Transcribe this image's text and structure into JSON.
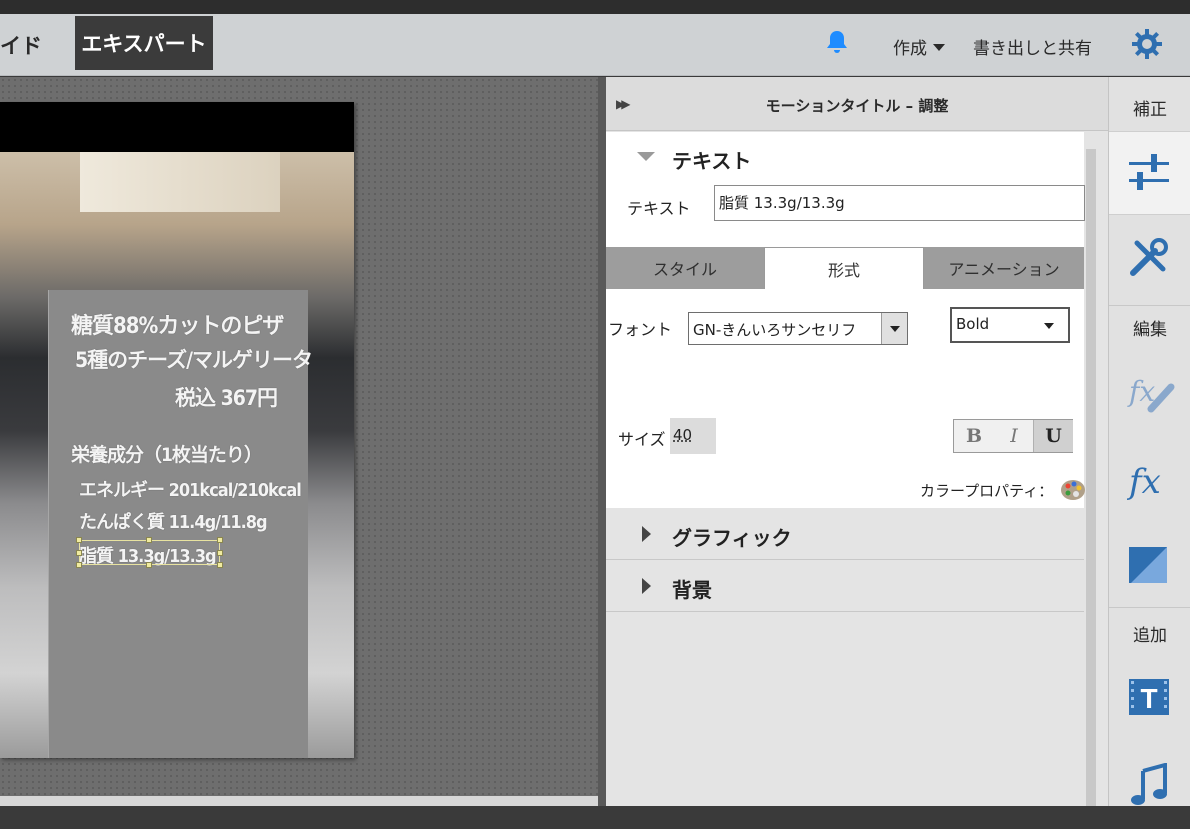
{
  "header": {
    "mode_left": "イド",
    "mode_expert": "エキスパート",
    "create_label": "作成",
    "export_label": "書き出しと共有",
    "icons": {
      "bell": "bell-icon",
      "gear": "gear-icon"
    },
    "accent": "#1f8cff"
  },
  "card": {
    "lines": [
      "糖質88%カットのピザ",
      "5種のチーズ/マルゲリータ",
      "税込 367円",
      "栄養成分（1枚当たり）",
      "エネルギー 201kcal/210kcal",
      "たんぱく質 11.4g/11.8g",
      "脂質 13.3g/13.3g"
    ]
  },
  "panel": {
    "title": "モーションタイトル – 調整",
    "text_section": "テキスト",
    "text_label": "テキスト",
    "text_value": "脂質 13.3g/13.3g",
    "tabs": [
      "スタイル",
      "形式",
      "アニメーション"
    ],
    "active_tab": "形式",
    "font_label": "フォント",
    "font_value": "GN-きんいろサンセリフ",
    "weight_value": "Bold",
    "size_label": "サイズ",
    "size_value": "40",
    "bold_label": "B",
    "italic_label": "I",
    "underline_label": "U",
    "color_label": "カラープロパティ：",
    "graphic_section": "グラフィック",
    "background_section": "背景"
  },
  "rightbar": {
    "correct_label": "補正",
    "edit_label": "編集",
    "add_label": "追加",
    "fx_label": "fx"
  }
}
